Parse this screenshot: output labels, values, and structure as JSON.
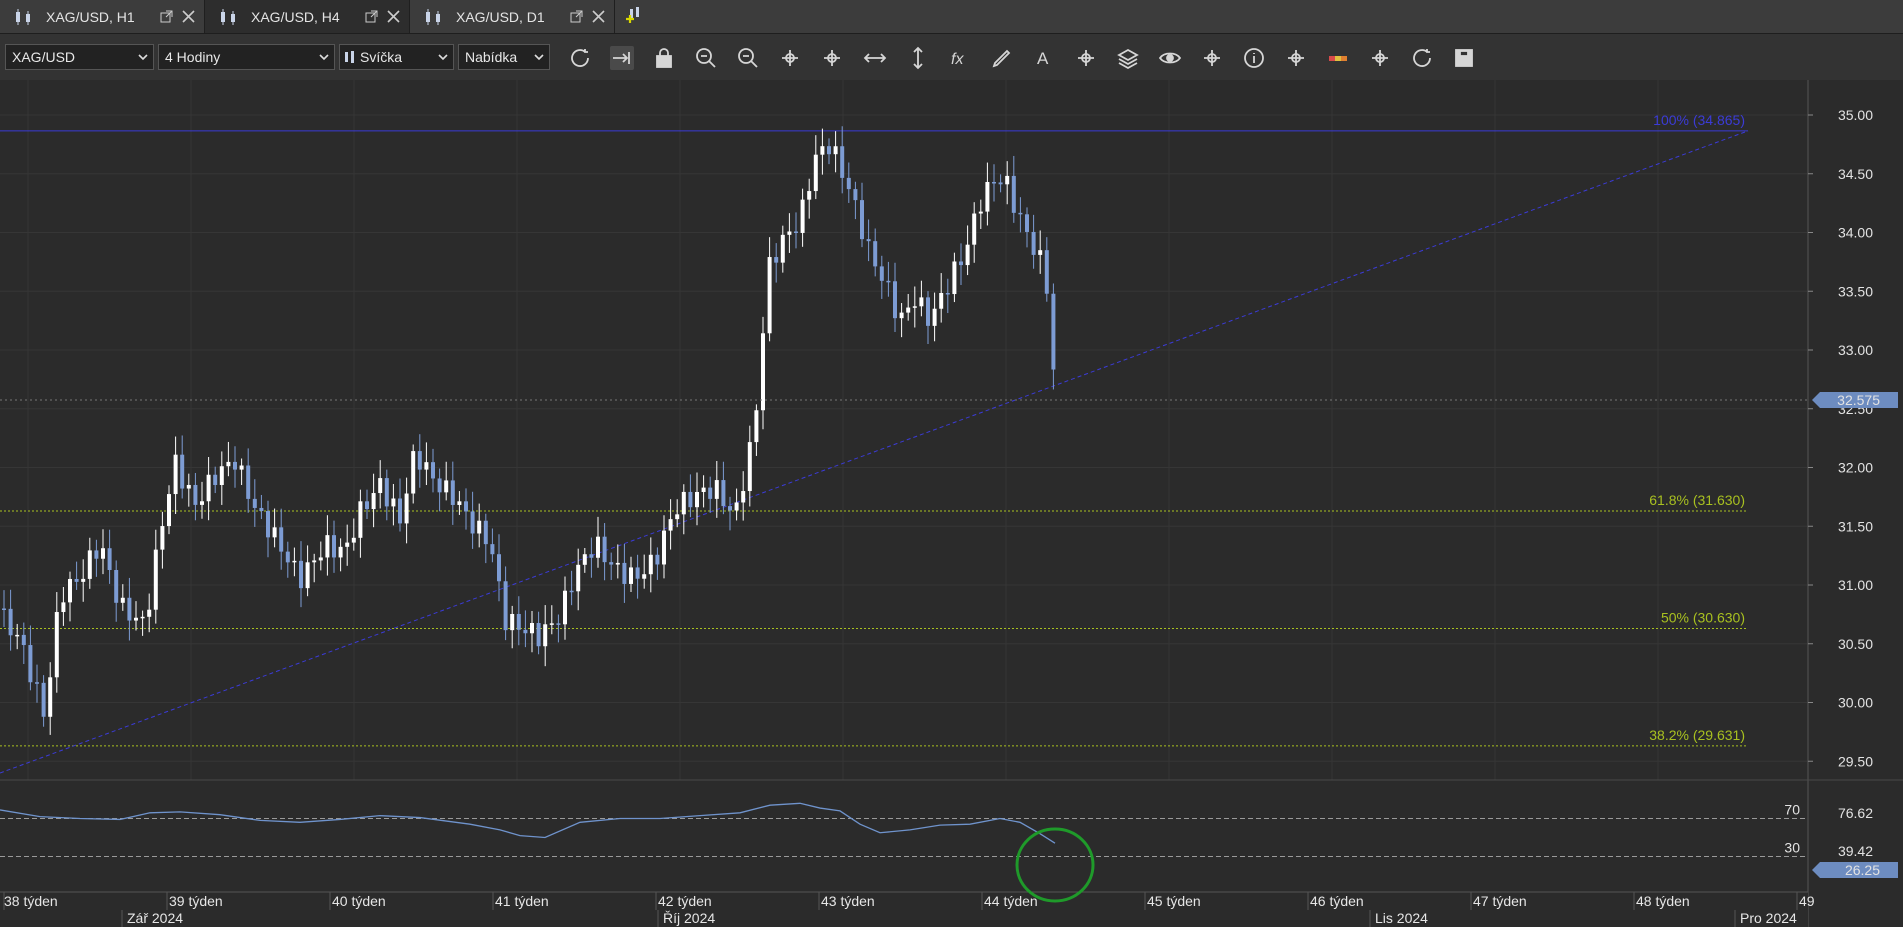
{
  "tabs": [
    {
      "label": "XAG/USD, H1",
      "active": false
    },
    {
      "label": "XAG/USD, H4",
      "active": true
    },
    {
      "label": "XAG/USD, D1",
      "active": false
    }
  ],
  "toolbar": {
    "instrument": "XAG/USD",
    "period": "4 Hodiny",
    "chart_type": "Svíčka",
    "price_side": "Nabídka",
    "icons": [
      "refresh-icon",
      "shift-chart-icon",
      "lock-icon",
      "zoom-in-icon",
      "zoom-out-icon",
      "undo-icon",
      "redo-icon",
      "horizontal-resize-icon",
      "vertical-resize-icon",
      "formula-icon",
      "pencil-icon",
      "text-tool-icon",
      "crosshair-tool-icon",
      "layers-icon",
      "eye-icon",
      "indicator-icon",
      "info-icon",
      "cursor-icon",
      "color-bar-icon",
      "paint-bucket-icon",
      "settings-wheel-icon",
      "save-icon"
    ]
  },
  "chart_data": {
    "type": "candlestick",
    "symbol": "XAG/USD",
    "timeframe": "4 Hodiny",
    "ylim": [
      29.3,
      35.25
    ],
    "yticks": [
      "35.00",
      "34.50",
      "34.00",
      "33.50",
      "33.00",
      "32.50",
      "32.00",
      "31.50",
      "31.00",
      "30.50",
      "30.00",
      "29.50"
    ],
    "current_price": "32.575",
    "fib_levels": [
      {
        "label": "100% (34.865)",
        "value": 34.865,
        "color": "#3b3bd6"
      },
      {
        "label": "61.8% (31.630)",
        "value": 31.63,
        "color": "#a8c020"
      },
      {
        "label": "50% (30.630)",
        "value": 30.63,
        "color": "#a8c020"
      },
      {
        "label": "38.2% (29.631)",
        "value": 29.631,
        "color": "#a8c020"
      }
    ],
    "price_path": [
      [
        0,
        30.8
      ],
      [
        20,
        30.6
      ],
      [
        45,
        29.9
      ],
      [
        60,
        30.9
      ],
      [
        80,
        31.0
      ],
      [
        100,
        31.3
      ],
      [
        120,
        30.8
      ],
      [
        145,
        30.7
      ],
      [
        160,
        31.5
      ],
      [
        175,
        32.1
      ],
      [
        195,
        31.7
      ],
      [
        215,
        31.9
      ],
      [
        235,
        32.0
      ],
      [
        255,
        31.6
      ],
      [
        275,
        31.4
      ],
      [
        300,
        31.1
      ],
      [
        325,
        31.4
      ],
      [
        345,
        31.3
      ],
      [
        360,
        31.6
      ],
      [
        380,
        31.8
      ],
      [
        400,
        31.5
      ],
      [
        415,
        32.1
      ],
      [
        435,
        31.9
      ],
      [
        455,
        31.8
      ],
      [
        470,
        31.6
      ],
      [
        490,
        31.4
      ],
      [
        505,
        30.7
      ],
      [
        520,
        30.6
      ],
      [
        540,
        30.5
      ],
      [
        560,
        30.7
      ],
      [
        575,
        31.1
      ],
      [
        595,
        31.4
      ],
      [
        615,
        31.2
      ],
      [
        635,
        31.1
      ],
      [
        655,
        31.2
      ],
      [
        675,
        31.6
      ],
      [
        695,
        31.7
      ],
      [
        715,
        31.8
      ],
      [
        735,
        31.6
      ],
      [
        755,
        32.4
      ],
      [
        760,
        33.0
      ],
      [
        770,
        33.8
      ],
      [
        785,
        34.0
      ],
      [
        800,
        34.1
      ],
      [
        815,
        34.6
      ],
      [
        830,
        34.7
      ],
      [
        850,
        34.3
      ],
      [
        870,
        33.8
      ],
      [
        885,
        33.6
      ],
      [
        900,
        33.3
      ],
      [
        915,
        33.5
      ],
      [
        930,
        33.3
      ],
      [
        950,
        33.6
      ],
      [
        965,
        33.8
      ],
      [
        980,
        34.2
      ],
      [
        995,
        34.4
      ],
      [
        1005,
        34.4
      ],
      [
        1020,
        34.1
      ],
      [
        1040,
        33.8
      ],
      [
        1050,
        33.5
      ],
      [
        1055,
        32.575
      ]
    ],
    "rsi": {
      "levels": [
        70,
        30
      ],
      "ytick_labels": [
        "76.62",
        "39.42"
      ],
      "current_value": "26.25",
      "path": [
        [
          0,
          79
        ],
        [
          40,
          72
        ],
        [
          80,
          70
        ],
        [
          120,
          69
        ],
        [
          150,
          76
        ],
        [
          180,
          77
        ],
        [
          220,
          74
        ],
        [
          260,
          68
        ],
        [
          300,
          66
        ],
        [
          340,
          69
        ],
        [
          380,
          73
        ],
        [
          420,
          71
        ],
        [
          470,
          64
        ],
        [
          500,
          58
        ],
        [
          520,
          52
        ],
        [
          545,
          50
        ],
        [
          580,
          66
        ],
        [
          620,
          70
        ],
        [
          660,
          70
        ],
        [
          700,
          73
        ],
        [
          740,
          76
        ],
        [
          770,
          84
        ],
        [
          800,
          86
        ],
        [
          820,
          81
        ],
        [
          840,
          78
        ],
        [
          860,
          64
        ],
        [
          880,
          55
        ],
        [
          910,
          58
        ],
        [
          940,
          63
        ],
        [
          970,
          64
        ],
        [
          1000,
          70
        ],
        [
          1020,
          66
        ],
        [
          1040,
          54
        ],
        [
          1055,
          44
        ]
      ]
    },
    "x_week_labels": [
      "38 týden",
      "39 týden",
      "40 týden",
      "41 týden",
      "42 týden",
      "43 týden",
      "44 týden",
      "45 týden",
      "46 týden",
      "47 týden",
      "48 týden",
      "49"
    ],
    "x_month_labels": [
      "Zář 2024",
      "Říj 2024",
      "Lis 2024",
      "Pro 2024"
    ]
  }
}
